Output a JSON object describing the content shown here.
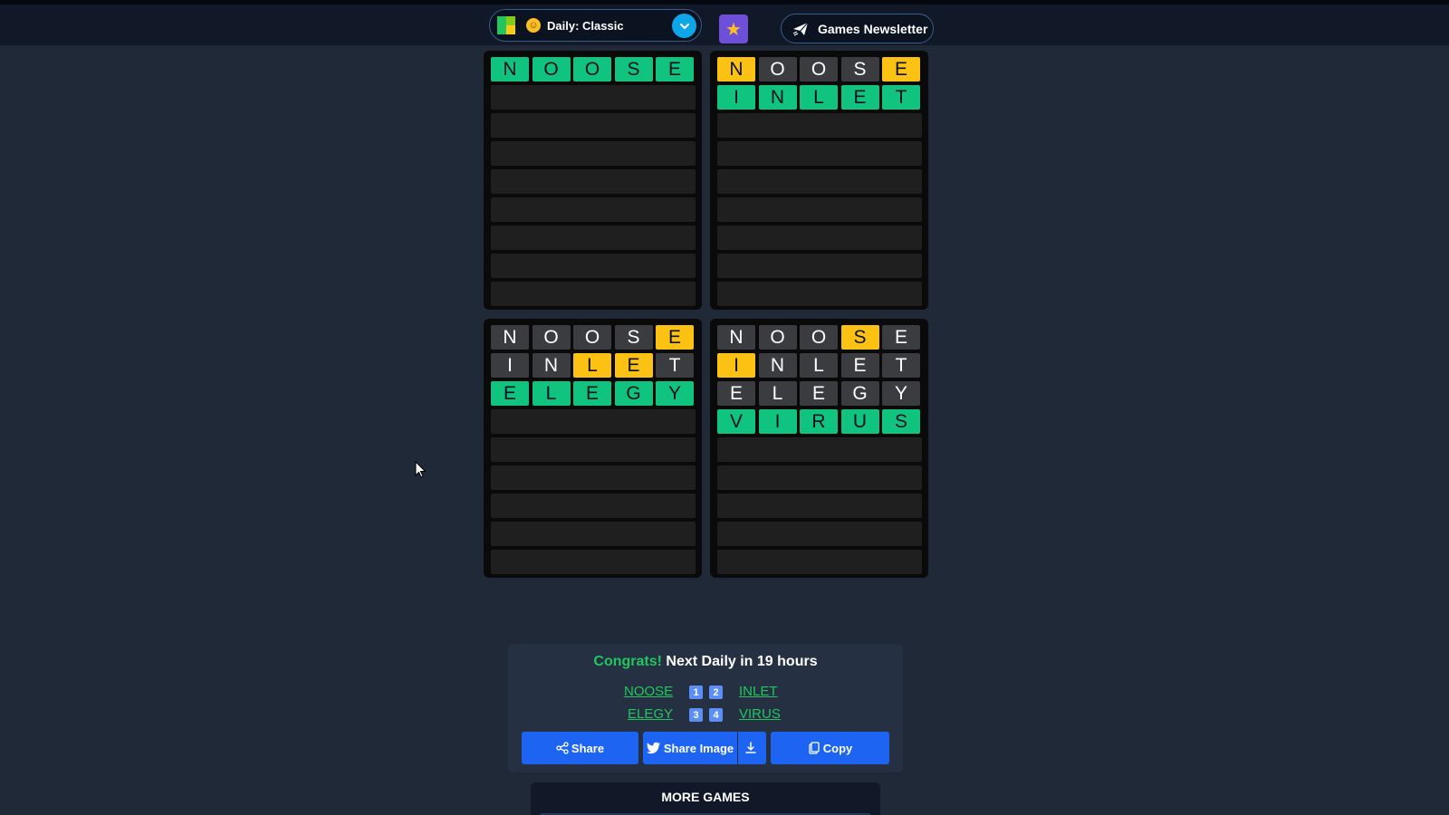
{
  "header": {
    "mode_label": "Daily: Classic",
    "newsletter_label": "Games Newsletter"
  },
  "boards": [
    {
      "rows": [
        [
          {
            "l": "N",
            "c": "green"
          },
          {
            "l": "O",
            "c": "green"
          },
          {
            "l": "O",
            "c": "green"
          },
          {
            "l": "S",
            "c": "green"
          },
          {
            "l": "E",
            "c": "green"
          }
        ]
      ],
      "total_rows": 9
    },
    {
      "rows": [
        [
          {
            "l": "N",
            "c": "yellow"
          },
          {
            "l": "O",
            "c": "gray"
          },
          {
            "l": "O",
            "c": "gray"
          },
          {
            "l": "S",
            "c": "gray"
          },
          {
            "l": "E",
            "c": "yellow"
          }
        ],
        [
          {
            "l": "I",
            "c": "green"
          },
          {
            "l": "N",
            "c": "green"
          },
          {
            "l": "L",
            "c": "green"
          },
          {
            "l": "E",
            "c": "green"
          },
          {
            "l": "T",
            "c": "green"
          }
        ]
      ],
      "total_rows": 9
    },
    {
      "rows": [
        [
          {
            "l": "N",
            "c": "gray"
          },
          {
            "l": "O",
            "c": "gray"
          },
          {
            "l": "O",
            "c": "gray"
          },
          {
            "l": "S",
            "c": "gray"
          },
          {
            "l": "E",
            "c": "yellow"
          }
        ],
        [
          {
            "l": "I",
            "c": "gray"
          },
          {
            "l": "N",
            "c": "gray"
          },
          {
            "l": "L",
            "c": "yellow"
          },
          {
            "l": "E",
            "c": "yellow"
          },
          {
            "l": "T",
            "c": "gray"
          }
        ],
        [
          {
            "l": "E",
            "c": "green"
          },
          {
            "l": "L",
            "c": "green"
          },
          {
            "l": "E",
            "c": "green"
          },
          {
            "l": "G",
            "c": "green"
          },
          {
            "l": "Y",
            "c": "green"
          }
        ]
      ],
      "total_rows": 9
    },
    {
      "rows": [
        [
          {
            "l": "N",
            "c": "gray"
          },
          {
            "l": "O",
            "c": "gray"
          },
          {
            "l": "O",
            "c": "gray"
          },
          {
            "l": "S",
            "c": "yellow"
          },
          {
            "l": "E",
            "c": "gray"
          }
        ],
        [
          {
            "l": "I",
            "c": "yellow"
          },
          {
            "l": "N",
            "c": "gray"
          },
          {
            "l": "L",
            "c": "gray"
          },
          {
            "l": "E",
            "c": "gray"
          },
          {
            "l": "T",
            "c": "gray"
          }
        ],
        [
          {
            "l": "E",
            "c": "gray"
          },
          {
            "l": "L",
            "c": "gray"
          },
          {
            "l": "E",
            "c": "gray"
          },
          {
            "l": "G",
            "c": "gray"
          },
          {
            "l": "Y",
            "c": "gray"
          }
        ],
        [
          {
            "l": "V",
            "c": "green"
          },
          {
            "l": "I",
            "c": "green"
          },
          {
            "l": "R",
            "c": "green"
          },
          {
            "l": "U",
            "c": "green"
          },
          {
            "l": "S",
            "c": "green"
          }
        ]
      ],
      "total_rows": 9
    }
  ],
  "result": {
    "congrats": "Congrats!",
    "next_daily": "Next Daily in 19 hours",
    "words": [
      "NOOSE",
      "INLET",
      "ELEGY",
      "VIRUS"
    ],
    "badges": [
      "1",
      "2",
      "3",
      "4"
    ],
    "share_label": "Share",
    "share_image_label": "Share Image",
    "copy_label": "Copy"
  },
  "more_games": {
    "title": "MORE GAMES"
  },
  "colors": {
    "green": "#10c37e",
    "yellow": "#fbc214",
    "gray": "#3a3c40",
    "button_blue": "#1d64f2",
    "background": "#1f2937"
  }
}
